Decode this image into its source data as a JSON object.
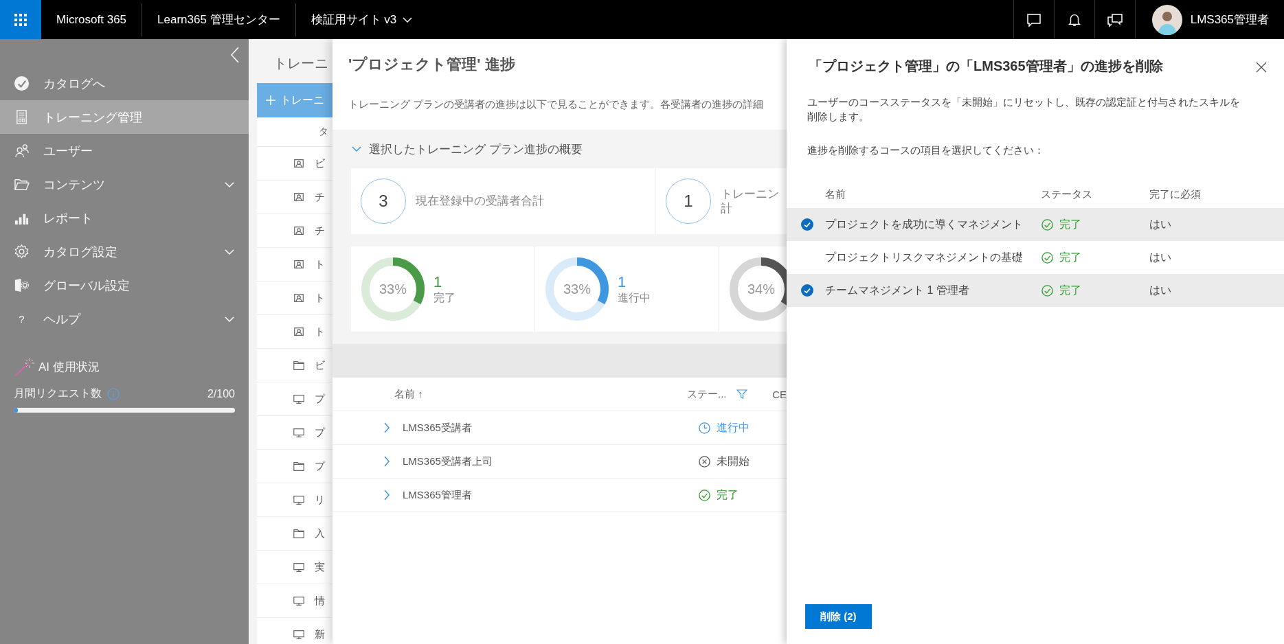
{
  "topbar": {
    "app_name": "Microsoft 365",
    "center_name": "Learn365 管理センター",
    "site": "検証用サイト v3",
    "user": "LMS365管理者"
  },
  "sidebar": {
    "items": [
      {
        "kind": "catalog",
        "label": "カタログへ",
        "expandable": false,
        "selected": false
      },
      {
        "kind": "training",
        "label": "トレーニング管理",
        "expandable": false,
        "selected": true
      },
      {
        "kind": "users",
        "label": "ユーザー",
        "expandable": false,
        "selected": false
      },
      {
        "kind": "folder",
        "label": "コンテンツ",
        "expandable": true,
        "selected": false
      },
      {
        "kind": "report",
        "label": "レポート",
        "expandable": false,
        "selected": false
      },
      {
        "kind": "gear",
        "label": "カタログ設定",
        "expandable": true,
        "selected": false
      },
      {
        "kind": "global",
        "label": "グローバル設定",
        "expandable": false,
        "selected": false
      },
      {
        "kind": "help",
        "glyph": "?",
        "label": "ヘルプ",
        "expandable": true,
        "selected": false
      }
    ],
    "ai": {
      "title": "AI 使用状況",
      "requests_label": "月間リクエスト数",
      "requests_count": "2/100",
      "level": 0.02
    }
  },
  "background_page": {
    "title": "トレーニ",
    "add_button": "トレーニ",
    "column_header": "タ",
    "rows": [
      {
        "kind": "course",
        "text": "ビ"
      },
      {
        "kind": "course",
        "text": "チ"
      },
      {
        "kind": "course",
        "text": "チ"
      },
      {
        "kind": "course",
        "text": "ト"
      },
      {
        "kind": "course",
        "text": "ト"
      },
      {
        "kind": "course",
        "text": "ト"
      },
      {
        "kind": "folder",
        "text": "ビ"
      },
      {
        "kind": "screen",
        "text": "プ"
      },
      {
        "kind": "screen",
        "text": "プ"
      },
      {
        "kind": "folder",
        "text": "プ"
      },
      {
        "kind": "screen",
        "text": "リ"
      },
      {
        "kind": "folder",
        "text": "入"
      },
      {
        "kind": "screen",
        "text": "実"
      },
      {
        "kind": "screen",
        "text": "情"
      },
      {
        "kind": "screen",
        "text": "新"
      }
    ]
  },
  "progress_panel": {
    "title": "'プロジェクト管理' 進捗",
    "description": "トレーニング プランの受講者の進捗は以下で見ることができます。各受講者の進捗の詳細",
    "summary": {
      "heading": "選択したトレーニング プラン進捗の概要",
      "expanded": true,
      "stats": [
        {
          "value": "3",
          "label": "現在登録中の受講者合計"
        },
        {
          "value": "1",
          "lines": [
            "トレーニン",
            "計"
          ]
        }
      ],
      "donuts": [
        {
          "percent": "33%",
          "level": 0.33,
          "color": "#4a9a48",
          "count": "1",
          "label": "完了"
        },
        {
          "percent": "33%",
          "level": 0.33,
          "color": "#3f97df",
          "count": "1",
          "label": "進行中"
        },
        {
          "percent": "34%",
          "color": "#555555"
        }
      ]
    },
    "table": {
      "columns": [
        "名前 ↑",
        "ステー...",
        "CE"
      ],
      "rows": [
        {
          "name": "LMS365受講者",
          "status": "進行中",
          "kind": "in_progress"
        },
        {
          "name": "LMS365受講者上司",
          "status": "未開始",
          "kind": "not_started"
        },
        {
          "name": "LMS365管理者",
          "status": "完了",
          "kind": "done"
        }
      ]
    }
  },
  "delete_panel": {
    "title": "「プロジェクト管理」の「LMS365管理者」の進捗を削除",
    "description": "ユーザーのコースステータスを「未開始」にリセットし、既存の認定証と付与されたスキルを削除します。",
    "instruction": "進捗を削除するコースの項目を選択してください：",
    "columns": [
      "名前",
      "ステータス",
      "完了に必須"
    ],
    "rows": [
      {
        "name": "プロジェクトを成功に導くマネジメント",
        "status": "完了",
        "required": "はい",
        "selected": true
      },
      {
        "name": "プロジェクトリスクマネジメントの基礎",
        "status": "完了",
        "required": "はい",
        "selected": false
      },
      {
        "name": "チームマネジメント 1 管理者",
        "status": "完了",
        "required": "はい",
        "selected": true
      }
    ],
    "delete_button": "削除 (2)"
  }
}
